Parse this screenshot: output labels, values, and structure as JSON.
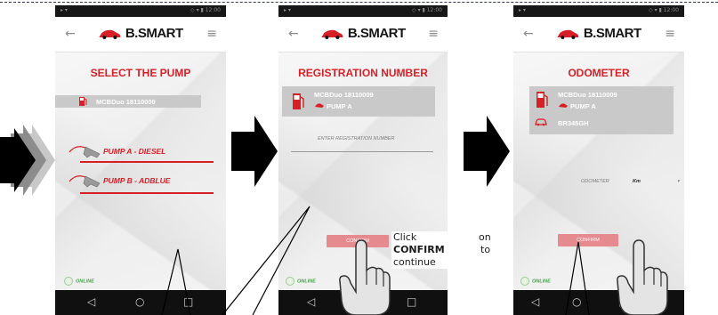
{
  "brand": {
    "name": "B.SMART",
    "accent_color": "#d61f26",
    "confirm_button_color": "#e58a8e",
    "online_color": "#44a64a"
  },
  "common": {
    "back_icon": "back-arrow-icon",
    "menu_icon": "hamburger-menu-icon",
    "online_label": "ONLINE",
    "device_name": "MCBDuo 18110009",
    "selected_pump": "PUMP A",
    "nav_icons": [
      "back-triangle-icon",
      "home-circle-icon",
      "recents-square-icon"
    ]
  },
  "screens": [
    {
      "title": "SELECT THE PUMP",
      "pump_options": [
        "PUMP A - DIESEL",
        "PUMP B - ADBLUE"
      ]
    },
    {
      "title": "REGISTRATION NUMBER",
      "field_label": "ENTER REGISTRATION NUMBER",
      "button_label": "CONFIRM"
    },
    {
      "title": "ODOMETER",
      "registration": "BR345GH",
      "field_label": "ODOMETER",
      "unit": "Km",
      "button_label": "CONFIRM"
    }
  ],
  "instruction": {
    "line1_word": "Click",
    "line1_end": "on",
    "line2_word": "CONFIRM",
    "line2_end": "to",
    "line3": "continue"
  }
}
